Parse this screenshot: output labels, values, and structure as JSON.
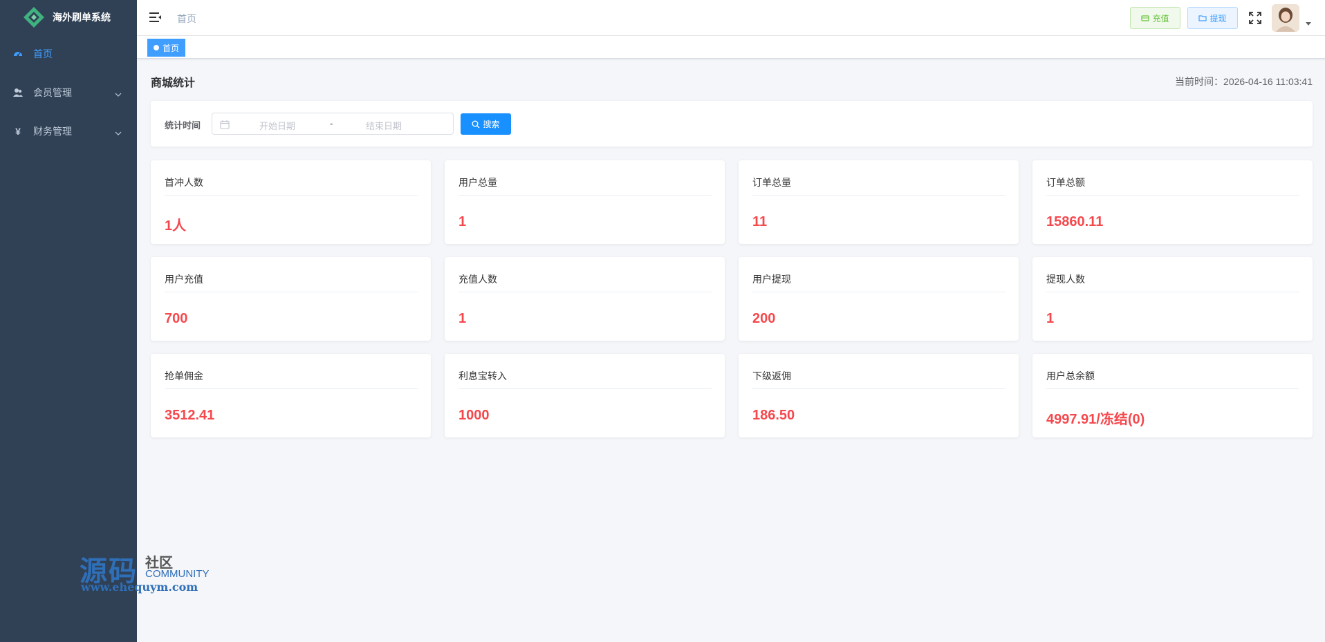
{
  "app": {
    "title": "海外刷单系统"
  },
  "sidebar": {
    "items": [
      {
        "label": "首页",
        "icon": "dashboard-icon",
        "active": true
      },
      {
        "label": "会员管理",
        "icon": "users-icon",
        "active": false
      },
      {
        "label": "财务管理",
        "icon": "yen-icon",
        "active": false
      }
    ]
  },
  "watermark": {
    "big": "源码",
    "small": "社区",
    "community": "COMMUNITY",
    "url": "www.ehequym.com"
  },
  "topbar": {
    "breadcrumb": "首页",
    "recharge_label": "充值",
    "withdraw_label": "提现"
  },
  "tags": {
    "active_label": "首页"
  },
  "main": {
    "title": "商城统计",
    "current_time": "当前时间：2026-04-16 11:03:41"
  },
  "filter": {
    "label": "统计时间",
    "start_placeholder": "开始日期",
    "separator": "-",
    "end_placeholder": "结束日期",
    "search_label": "搜索"
  },
  "stats": [
    {
      "title": "首冲人数",
      "value": "1人"
    },
    {
      "title": "用户总量",
      "value": "1"
    },
    {
      "title": "订单总量",
      "value": "11"
    },
    {
      "title": "订单总额",
      "value": "15860.11"
    },
    {
      "title": "用户充值",
      "value": "700"
    },
    {
      "title": "充值人数",
      "value": "1"
    },
    {
      "title": "用户提现",
      "value": "200"
    },
    {
      "title": "提现人数",
      "value": "1"
    },
    {
      "title": "抢单佣金",
      "value": "3512.41"
    },
    {
      "title": "利息宝转入",
      "value": "1000"
    },
    {
      "title": "下级返佣",
      "value": "186.50"
    },
    {
      "title": "用户总余额",
      "value": "4997.91/冻结(0)"
    }
  ],
  "colors": {
    "sidebar": "#304156",
    "accent": "#409eff",
    "value": "#f5484d"
  }
}
